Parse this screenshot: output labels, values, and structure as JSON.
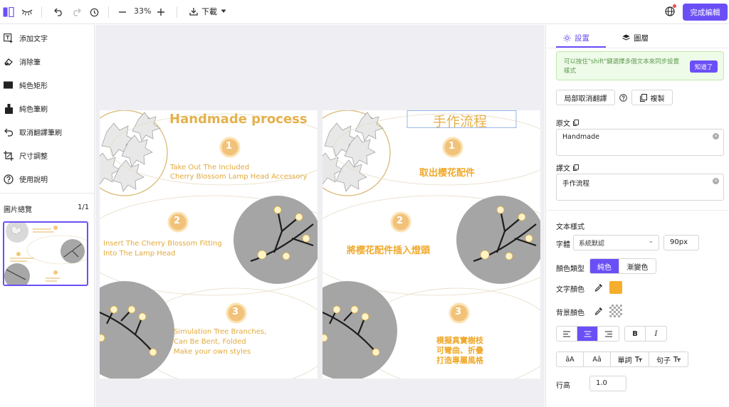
{
  "toolbar": {
    "zoom_value": "33%",
    "download_label": "下載",
    "done_label": "完成編輯"
  },
  "sidebar": {
    "tools": [
      {
        "label": "添加文字",
        "icon": "add-text-icon"
      },
      {
        "label": "消除筆",
        "icon": "eraser-icon"
      },
      {
        "label": "純色矩形",
        "icon": "rectangle-icon"
      },
      {
        "label": "純色筆刷",
        "icon": "brush-icon"
      },
      {
        "label": "取消翻譯筆刷",
        "icon": "undo-brush-icon"
      },
      {
        "label": "尺寸調整",
        "icon": "resize-icon"
      },
      {
        "label": "使用說明",
        "icon": "help-icon"
      }
    ],
    "overview_title": "圖片總覽",
    "overview_count": "1/1"
  },
  "poster_original": {
    "title": "Handmade process",
    "step1_num": "1",
    "step1_line1": "Take Out The Included",
    "step1_line2": "Cherry Blossom Lamp Head Accessory",
    "step2_num": "2",
    "step2_line1": "Insert The Cherry Blossom Fitting",
    "step2_line2": "Into The Lamp Head",
    "step3_num": "3",
    "step3_line1": "Simulation Tree Branches,",
    "step3_line2": "Can Be Bent, Folded",
    "step3_line3": "Make your own styles"
  },
  "poster_translated": {
    "title": "手作流程",
    "step1_num": "1",
    "step1_text": "取出櫻花配件",
    "step2_num": "2",
    "step2_text": "將櫻花配件插入燈頭",
    "step3_num": "3",
    "step3_line1": "模擬真實樹枝",
    "step3_line2": "可彎曲、折疊",
    "step3_line3": "打造專屬風格"
  },
  "right_panel": {
    "tab_settings": "設置",
    "tab_layers": "圖層",
    "tip_text": "可以按住\"shift\"鍵選擇多個文本來同步設置樣式",
    "tip_button": "知道了",
    "partial_untranslate": "局部取消翻譯",
    "copy_label": "複製",
    "original_label": "原文",
    "original_value": "Handmade",
    "translation_label": "譯文",
    "translation_value": "手作流程",
    "text_style_title": "文本樣式",
    "font_label": "字體",
    "font_value": "系統默認",
    "font_size": "90px",
    "color_type_label": "顏色類型",
    "color_solid": "純色",
    "color_gradient": "漸變色",
    "text_color_label": "文字顏色",
    "bg_color_label": "背景顏色",
    "text_color_hex": "#f5ae2c",
    "bold_label": "B",
    "italic_label": "I",
    "case_upper": "āA",
    "case_lower": "Aā",
    "word_label": "單詞",
    "sentence_label": "句子",
    "line_height_label": "行高",
    "line_height_value": "1.0"
  },
  "colors": {
    "accent": "#6b4ff6",
    "gold": "#e9b54c",
    "poster_text": "#e0a93a"
  }
}
